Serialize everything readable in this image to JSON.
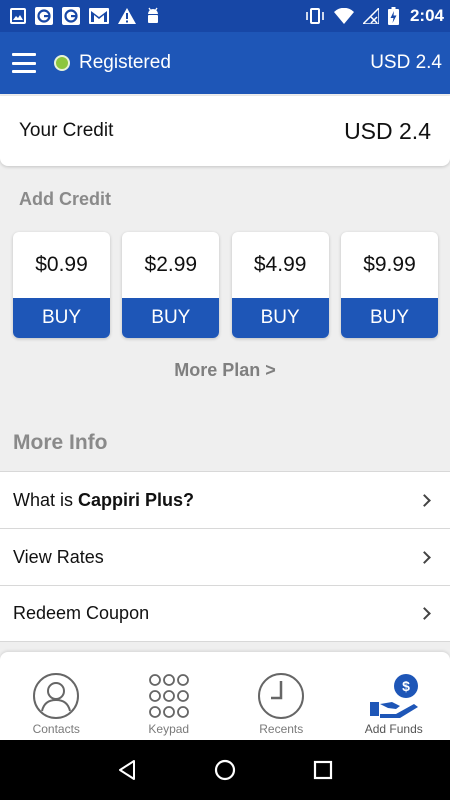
{
  "status_bar": {
    "time": "2:04",
    "icons": [
      "image-icon",
      "g-notification-icon",
      "g-notification-icon",
      "gmail-icon",
      "warning-icon",
      "android-icon",
      "vibrate-icon",
      "wifi-icon",
      "no-signal-icon",
      "battery-charging-icon"
    ]
  },
  "header": {
    "status_label": "Registered",
    "balance": "USD 2.4",
    "status_color": "#8cc63e",
    "brand_color": "#1e56b7"
  },
  "credit": {
    "label": "Your Credit",
    "value": "USD 2.4"
  },
  "add_credit": {
    "heading": "Add Credit",
    "plans": [
      {
        "price": "$0.99",
        "buy_label": "BUY"
      },
      {
        "price": "$2.99",
        "buy_label": "BUY"
      },
      {
        "price": "$4.99",
        "buy_label": "BUY"
      },
      {
        "price": "$9.99",
        "buy_label": "BUY"
      }
    ],
    "more_plan_label": "More Plan >"
  },
  "more_info": {
    "heading": "More Info",
    "items": [
      {
        "prefix": "What is ",
        "bold": "Cappiri Plus?"
      },
      {
        "prefix": "View Rates",
        "bold": ""
      },
      {
        "prefix": "Redeem Coupon",
        "bold": ""
      }
    ]
  },
  "bottom_nav": {
    "items": [
      {
        "label": "Contacts",
        "icon": "contacts-icon"
      },
      {
        "label": "Keypad",
        "icon": "keypad-icon"
      },
      {
        "label": "Recents",
        "icon": "clock-icon"
      },
      {
        "label": "Add Funds",
        "icon": "add-funds-icon",
        "active": true
      }
    ]
  },
  "android_nav": {
    "buttons": [
      "back-icon",
      "home-icon",
      "recents-icon"
    ]
  }
}
